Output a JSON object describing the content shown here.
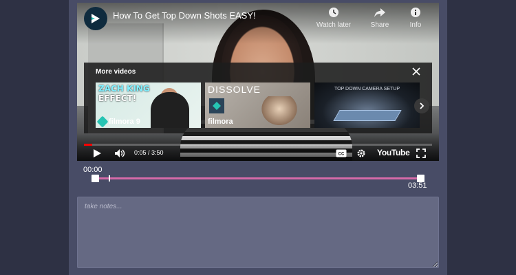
{
  "video": {
    "title": "How To Get Top Down Shots EASY!",
    "actions": [
      {
        "label": "Watch later",
        "icon": "clock-icon"
      },
      {
        "label": "Share",
        "icon": "share-icon"
      },
      {
        "label": "Info",
        "icon": "info-icon"
      }
    ],
    "more_videos": {
      "heading": "More videos",
      "thumbnails": [
        {
          "line1": "ZACH KING",
          "line2": "EFFECT!",
          "brand": "filmora 9"
        },
        {
          "headline": "DISSOLVE",
          "brand": "filmora"
        },
        {
          "headline": "TOP DOWN CAMERA SETUP"
        }
      ]
    },
    "progress_fraction": 0.024,
    "time": {
      "current": "0:05",
      "separator": " / ",
      "duration": "3:50"
    },
    "player_brand": "YouTube",
    "colors": {
      "progress": "#ff0000",
      "overlay": "#1c1c1c"
    }
  },
  "trimmer": {
    "start_label": "00:00",
    "end_label": "03:51",
    "playhead_fraction": 0.025,
    "color": "#d66aa8"
  },
  "notes": {
    "placeholder": "take notes...",
    "value": ""
  }
}
